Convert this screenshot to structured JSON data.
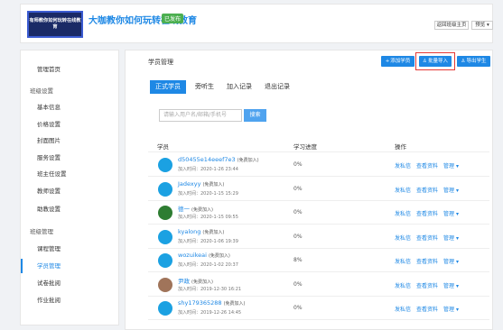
{
  "header": {
    "logo_text": "有师教你如何玩转在线教育",
    "course_title": "大咖教你如何玩转在线教育",
    "status_badge": "已发布",
    "back_button": "返回班级主页",
    "preview_button": "预览 ▾"
  },
  "sidebar": {
    "items": [
      {
        "label": "管理首页",
        "group": false,
        "active": false
      },
      {
        "label": "班级设置",
        "group": true,
        "active": false
      },
      {
        "label": "基本信息",
        "group": false,
        "active": false
      },
      {
        "label": "价格设置",
        "group": false,
        "active": false
      },
      {
        "label": "封面图片",
        "group": false,
        "active": false
      },
      {
        "label": "服务设置",
        "group": false,
        "active": false
      },
      {
        "label": "班主任设置",
        "group": false,
        "active": false
      },
      {
        "label": "教师设置",
        "group": false,
        "active": false
      },
      {
        "label": "助教设置",
        "group": false,
        "active": false
      },
      {
        "label": "班级管理",
        "group": true,
        "active": false
      },
      {
        "label": "课程管理",
        "group": false,
        "active": false
      },
      {
        "label": "学员管理",
        "group": false,
        "active": true
      },
      {
        "label": "试卷批阅",
        "group": false,
        "active": false
      },
      {
        "label": "作业批阅",
        "group": false,
        "active": false
      }
    ]
  },
  "main": {
    "title": "学员管理",
    "actions": {
      "add": "添加学员",
      "import": "批量导入",
      "export": "导出学生"
    },
    "tabs": [
      "正式学员",
      "旁听生",
      "加入记录",
      "退出记录"
    ],
    "search": {
      "placeholder": "请输入用户名/邮箱/手机号",
      "button": "搜索"
    },
    "table": {
      "headers": [
        "学员",
        "学习进度",
        "操作"
      ],
      "op_labels": {
        "send": "发私信",
        "view": "查看资料",
        "manage": "管理 ▾"
      },
      "rows": [
        {
          "name": "d50455e14eeef7e3",
          "tag": "(免费加入)",
          "time": "加入时间：2020-1-26 23:44",
          "progress": "0%",
          "avatar": "blue"
        },
        {
          "name": "Jadexyy",
          "tag": "(免费加入)",
          "time": "加入时间：2020-1-15 15:29",
          "progress": "0%",
          "avatar": "blue"
        },
        {
          "name": "德一",
          "tag": "(免费加入)",
          "time": "加入时间：2020-1-15 09:55",
          "progress": "0%",
          "avatar": "green"
        },
        {
          "name": "kyalong",
          "tag": "(免费加入)",
          "time": "加入时间：2020-1-06 19:39",
          "progress": "0%",
          "avatar": "blue"
        },
        {
          "name": "wozuikeai",
          "tag": "(免费加入)",
          "time": "加入时间：2020-1-02 20:37",
          "progress": "8%",
          "avatar": "blue"
        },
        {
          "name": "尹政",
          "tag": "(免费加入)",
          "time": "加入时间：2019-12-30 16:21",
          "progress": "0%",
          "avatar": "photo"
        },
        {
          "name": "shy179365288",
          "tag": "(免费加入)",
          "time": "加入时间：2019-12-26 14:45",
          "progress": "0%",
          "avatar": "blue"
        }
      ]
    }
  },
  "colors": {
    "accent": "#1e88e5",
    "badge": "#4caf50",
    "highlight": "#e53935"
  }
}
